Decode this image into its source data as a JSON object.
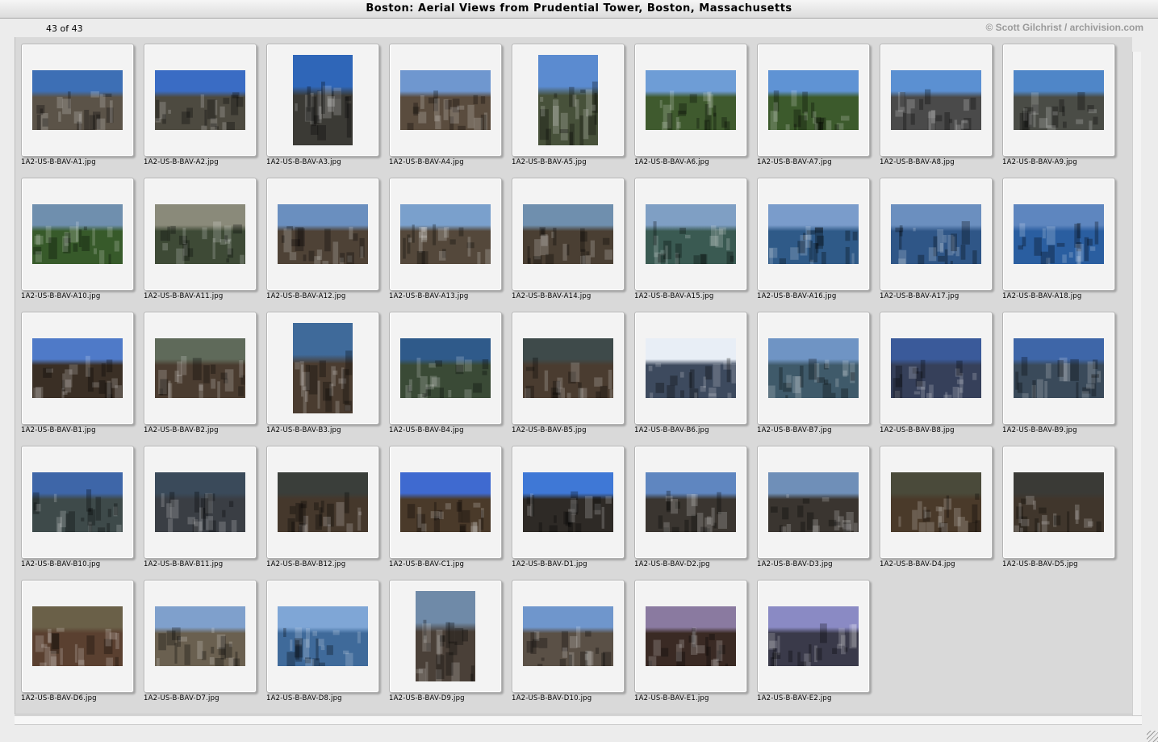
{
  "window": {
    "title": "Boston: Aerial Views from Prudential Tower, Boston, Massachusetts"
  },
  "header": {
    "count": "43 of 43",
    "copyright": "© Scott Gilchrist / archivision.com"
  },
  "thumbnails": [
    {
      "filename": "1A2-US-B-BAV-A1.jpg",
      "orientation": "landscape",
      "sky": "#3d6fb5",
      "ground": "#5b5348"
    },
    {
      "filename": "1A2-US-B-BAV-A2.jpg",
      "orientation": "landscape",
      "sky": "#3a6cc4",
      "ground": "#4d4a40"
    },
    {
      "filename": "1A2-US-B-BAV-A3.jpg",
      "orientation": "portrait",
      "sky": "#2f66b8",
      "ground": "#3b3a35"
    },
    {
      "filename": "1A2-US-B-BAV-A4.jpg",
      "orientation": "landscape",
      "sky": "#6f97cf",
      "ground": "#5a4c3e"
    },
    {
      "filename": "1A2-US-B-BAV-A5.jpg",
      "orientation": "portrait",
      "sky": "#5b8bd0",
      "ground": "#47513a"
    },
    {
      "filename": "1A2-US-B-BAV-A6.jpg",
      "orientation": "landscape",
      "sky": "#6e9dd6",
      "ground": "#3f5a2e"
    },
    {
      "filename": "1A2-US-B-BAV-A7.jpg",
      "orientation": "landscape",
      "sky": "#5f93d4",
      "ground": "#3c5a2c"
    },
    {
      "filename": "1A2-US-B-BAV-A8.jpg",
      "orientation": "landscape",
      "sky": "#5b90d2",
      "ground": "#4a4a4a"
    },
    {
      "filename": "1A2-US-B-BAV-A9.jpg",
      "orientation": "landscape",
      "sky": "#4f86c8",
      "ground": "#4a4c46"
    },
    {
      "filename": "1A2-US-B-BAV-A10.jpg",
      "orientation": "landscape",
      "sky": "#6f8fae",
      "ground": "#375a2a"
    },
    {
      "filename": "1A2-US-B-BAV-A11.jpg",
      "orientation": "landscape",
      "sky": "#8a8a7a",
      "ground": "#3e4a36"
    },
    {
      "filename": "1A2-US-B-BAV-A12.jpg",
      "orientation": "landscape",
      "sky": "#6a8fbf",
      "ground": "#4e4236"
    },
    {
      "filename": "1A2-US-B-BAV-A13.jpg",
      "orientation": "landscape",
      "sky": "#7aa0cc",
      "ground": "#54483b"
    },
    {
      "filename": "1A2-US-B-BAV-A14.jpg",
      "orientation": "landscape",
      "sky": "#6f8fae",
      "ground": "#4a3f33"
    },
    {
      "filename": "1A2-US-B-BAV-A15.jpg",
      "orientation": "landscape",
      "sky": "#7f9fc4",
      "ground": "#3a5a52"
    },
    {
      "filename": "1A2-US-B-BAV-A16.jpg",
      "orientation": "landscape",
      "sky": "#7a9ccb",
      "ground": "#2f5a88"
    },
    {
      "filename": "1A2-US-B-BAV-A17.jpg",
      "orientation": "landscape",
      "sky": "#6b8fbf",
      "ground": "#2f5687"
    },
    {
      "filename": "1A2-US-B-BAV-A18.jpg",
      "orientation": "landscape",
      "sky": "#5e86bf",
      "ground": "#2a5ea0"
    },
    {
      "filename": "1A2-US-B-BAV-B1.jpg",
      "orientation": "landscape",
      "sky": "#4f7ac8",
      "ground": "#3a2f25"
    },
    {
      "filename": "1A2-US-B-BAV-B2.jpg",
      "orientation": "landscape",
      "sky": "#5f6a5a",
      "ground": "#4a3c30"
    },
    {
      "filename": "1A2-US-B-BAV-B3.jpg",
      "orientation": "portrait",
      "sky": "#3f6a9a",
      "ground": "#4a3c30"
    },
    {
      "filename": "1A2-US-B-BAV-B4.jpg",
      "orientation": "landscape",
      "sky": "#2f5a8a",
      "ground": "#3a4a36"
    },
    {
      "filename": "1A2-US-B-BAV-B5.jpg",
      "orientation": "landscape",
      "sky": "#3e4a4a",
      "ground": "#4a3c30"
    },
    {
      "filename": "1A2-US-B-BAV-B6.jpg",
      "orientation": "landscape",
      "sky": "#e8eef6",
      "ground": "#3d4a5e"
    },
    {
      "filename": "1A2-US-B-BAV-B7.jpg",
      "orientation": "landscape",
      "sky": "#6f94c4",
      "ground": "#3f5a6a"
    },
    {
      "filename": "1A2-US-B-BAV-B8.jpg",
      "orientation": "landscape",
      "sky": "#3a5a9a",
      "ground": "#36405a"
    },
    {
      "filename": "1A2-US-B-BAV-B9.jpg",
      "orientation": "landscape",
      "sky": "#3e66a8",
      "ground": "#3a4a5a"
    },
    {
      "filename": "1A2-US-B-BAV-B10.jpg",
      "orientation": "landscape",
      "sky": "#3e66a8",
      "ground": "#3e4a4a"
    },
    {
      "filename": "1A2-US-B-BAV-B11.jpg",
      "orientation": "landscape",
      "sky": "#3a4a5a",
      "ground": "#3a3e44"
    },
    {
      "filename": "1A2-US-B-BAV-B12.jpg",
      "orientation": "landscape",
      "sky": "#3a3e3a",
      "ground": "#45382c"
    },
    {
      "filename": "1A2-US-B-BAV-C1.jpg",
      "orientation": "landscape",
      "sky": "#3f6ad0",
      "ground": "#4a3a2a"
    },
    {
      "filename": "1A2-US-B-BAV-D1.jpg",
      "orientation": "landscape",
      "sky": "#3f78d6",
      "ground": "#2e2a26"
    },
    {
      "filename": "1A2-US-B-BAV-D2.jpg",
      "orientation": "landscape",
      "sky": "#5f86c0",
      "ground": "#3a3530"
    },
    {
      "filename": "1A2-US-B-BAV-D3.jpg",
      "orientation": "landscape",
      "sky": "#6f8fb8",
      "ground": "#3a3530"
    },
    {
      "filename": "1A2-US-B-BAV-D4.jpg",
      "orientation": "landscape",
      "sky": "#4a4a3a",
      "ground": "#4a3a2a"
    },
    {
      "filename": "1A2-US-B-BAV-D5.jpg",
      "orientation": "landscape",
      "sky": "#3a3a36",
      "ground": "#40362c"
    },
    {
      "filename": "1A2-US-B-BAV-D6.jpg",
      "orientation": "landscape",
      "sky": "#6a6048",
      "ground": "#5a4030"
    },
    {
      "filename": "1A2-US-B-BAV-D7.jpg",
      "orientation": "landscape",
      "sky": "#7fa0cc",
      "ground": "#6a6050"
    },
    {
      "filename": "1A2-US-B-BAV-D8.jpg",
      "orientation": "landscape",
      "sky": "#7fa6d6",
      "ground": "#3f6a9a"
    },
    {
      "filename": "1A2-US-B-BAV-D9.jpg",
      "orientation": "portrait",
      "sky": "#6f8aa8",
      "ground": "#4a4038"
    },
    {
      "filename": "1A2-US-B-BAV-D10.jpg",
      "orientation": "landscape",
      "sky": "#6f96cc",
      "ground": "#5a5046"
    },
    {
      "filename": "1A2-US-B-BAV-E1.jpg",
      "orientation": "landscape",
      "sky": "#8a7aa0",
      "ground": "#3a2a24"
    },
    {
      "filename": "1A2-US-B-BAV-E2.jpg",
      "orientation": "landscape",
      "sky": "#8a8ac4",
      "ground": "#3a3a4a"
    }
  ]
}
